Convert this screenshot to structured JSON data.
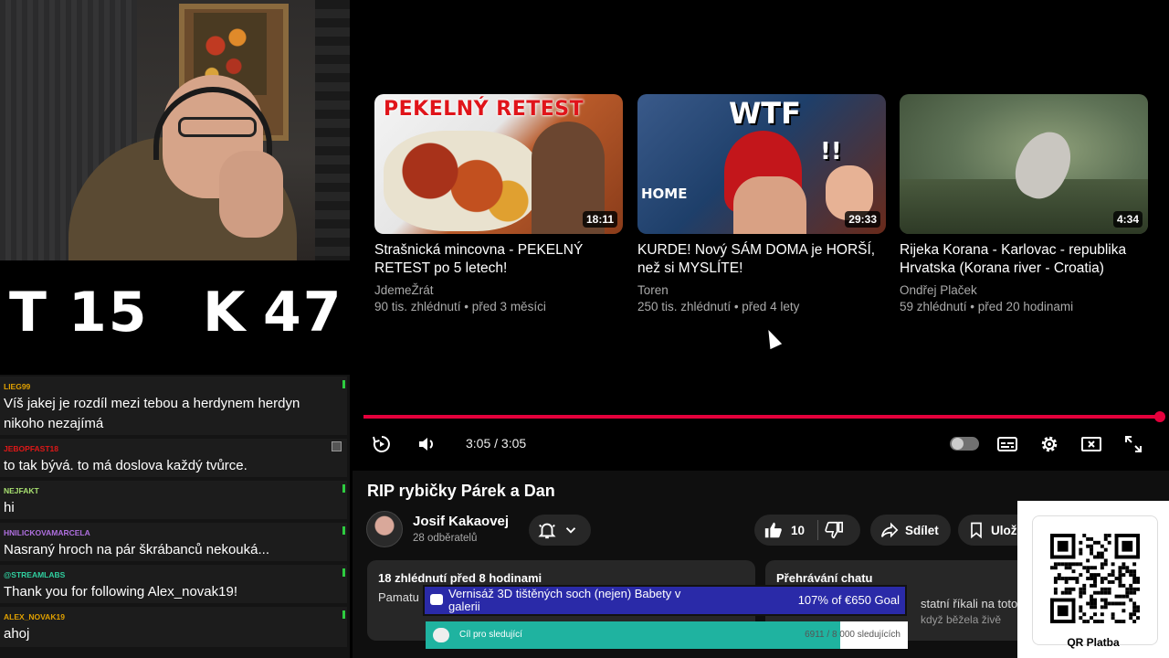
{
  "scoreboard": {
    "team_a": "T",
    "team_a_score": "15",
    "team_b": "K",
    "team_b_score": "47"
  },
  "chat": {
    "messages": [
      {
        "user": "LIEG99",
        "user_color": "#e0a000",
        "text": "Víš jakej je rozdíl mezi tebou a herdynem herdyn nikoho nezajímá"
      },
      {
        "user": "JEBOPFAST18",
        "user_color": "#e01818",
        "text": "to tak bývá. to má doslova každý tvůrce."
      },
      {
        "user": "NEJFAKT",
        "user_color": "#a8e070",
        "text": "hi"
      },
      {
        "user": "HNILICKOVAMARCELA",
        "user_color": "#b070e0",
        "text": "Nasraný hroch na pár škrábanců nekouká..."
      },
      {
        "user": "@STREAMLABS",
        "user_color": "#30d0a0",
        "text": "Thank you for following Alex_novak19!"
      },
      {
        "user": "ALEX_NOVAK19",
        "user_color": "#e0a000",
        "text": "ahoj"
      }
    ]
  },
  "recommendations": [
    {
      "thumb_caption": "PEKELNÝ RETEST",
      "duration": "18:11",
      "title": "Strašnická mincovna - PEKELNÝ RETEST po 5 letech!",
      "channel": "JdemeŽrát",
      "meta": "90 tis. zhlédnutí • před 3 měsíci"
    },
    {
      "thumb_caption": "WTF",
      "thumb_caption2": "!!",
      "thumb_caption3": "HOME",
      "duration": "29:33",
      "title": "KURDE! Nový SÁM DOMA je HORŠÍ, než si MYSLÍTE!",
      "channel": "Toren",
      "meta": "250 tis. zhlédnutí • před 4 lety"
    },
    {
      "duration": "4:34",
      "title": "Rijeka Korana - Karlovac - republika Hrvatska (Korana river - Croatia)",
      "channel": "Ondřej Plaček",
      "meta": "59 zhlédnutí • před 20 hodinami"
    }
  ],
  "player": {
    "progress": 1.0,
    "time": "3:05 / 3:05",
    "accent": "#e5003c"
  },
  "video": {
    "title": "RIP rybičky Párek a Dan",
    "channel": "Josif Kakaovej",
    "subscribers": "28 odběratelů",
    "likes": "10",
    "share_label": "Sdílet",
    "save_label": "Ulož",
    "description_meta": "18 zhlédnutí  před 8 hodinami",
    "description_text": "Pamatu",
    "chat_replay_title": "Přehrávání chatu",
    "chat_replay_text": "statní říkali na toto vi",
    "chat_replay_text2": "když běžela živě"
  },
  "overlay": {
    "event_title": "Vernisáž 3D tištěných soch (nejen) Babety v galerii",
    "event_goal": "107% of €650 Goal",
    "event_color": "#2a2aa8",
    "follow_label": "Cíl pro sledující",
    "follow_count": "6911 / 8 000 sledujících",
    "follow_progress": 0.86,
    "follow_color": "#1fb3a0",
    "qr_label": "QR Platba"
  }
}
